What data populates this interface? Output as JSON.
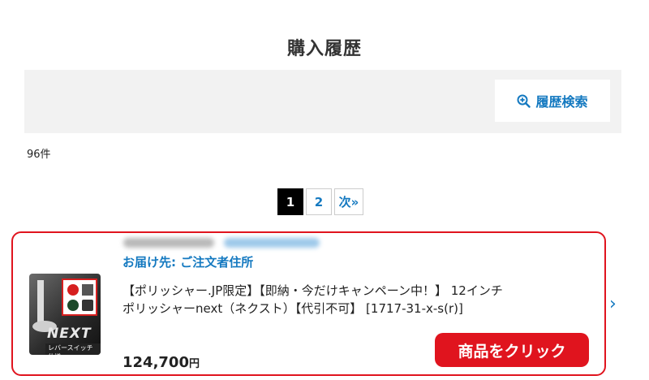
{
  "page": {
    "title": "購入履歴"
  },
  "search": {
    "button_label": "履歴検索",
    "icon": "zoom-in-icon"
  },
  "results": {
    "count": "96件"
  },
  "pagination": {
    "pages": [
      "1",
      "2"
    ],
    "active": "1",
    "next_label": "次»"
  },
  "order": {
    "delivery": "お届け先: ご注文者住所",
    "product_line1": "【ポリッシャー.JP限定】【即納・今だけキャンペーン中！】 12インチ",
    "product_line2": "ポリッシャーnext（ネクスト）【代引不可】 [1717-31-x-s(r)]",
    "price": "124,700",
    "price_unit": "円",
    "thumbnail": {
      "logo_text": "NEXT",
      "sub_text": "レバースイッチ仕様"
    },
    "cta_label": "商品をクリック"
  },
  "colors": {
    "accent_blue": "#1479c0",
    "cta_red": "#e0141e",
    "panel_bg": "#f2f2f2"
  }
}
